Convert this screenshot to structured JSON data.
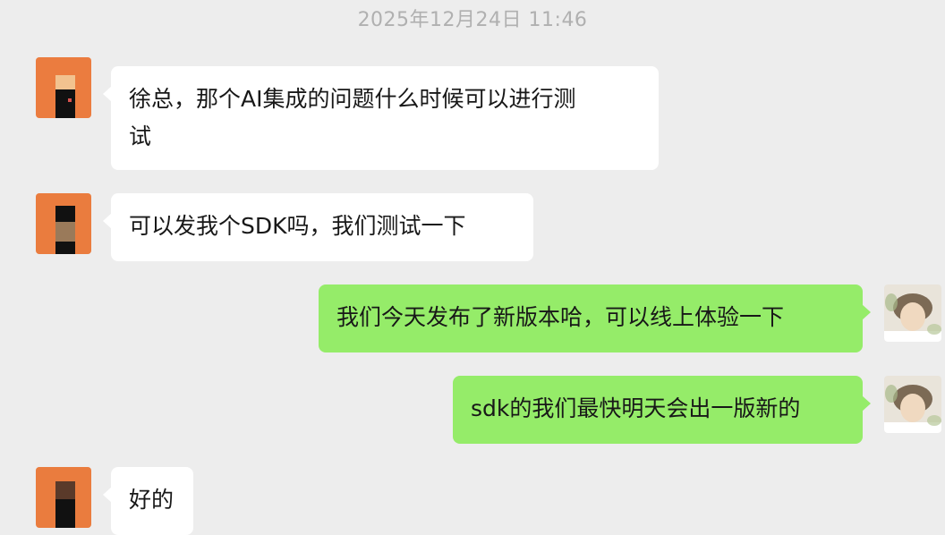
{
  "chat": {
    "timestamp": "2025年12月24日 11:46",
    "messages": [
      {
        "side": "left",
        "text": "徐总，那个AI集成的问题什么时候可以进行测\n试",
        "avatar": "contact-avatar"
      },
      {
        "side": "left",
        "text": "可以发我个SDK吗，我们测试一下",
        "avatar": "contact-avatar"
      },
      {
        "side": "right",
        "text": "我们今天发布了新版本哈，可以线上体验一下",
        "avatar": "self-avatar"
      },
      {
        "side": "right",
        "text": "sdk的我们最快明天会出一版新的",
        "avatar": "self-avatar"
      },
      {
        "side": "left",
        "text": "好的",
        "avatar": "contact-avatar"
      }
    ]
  },
  "colors": {
    "background": "#ededed",
    "incoming_bubble": "#ffffff",
    "outgoing_bubble": "#95ec69",
    "timestamp_text": "#b0b0b0",
    "contact_avatar": "#e8763a"
  }
}
